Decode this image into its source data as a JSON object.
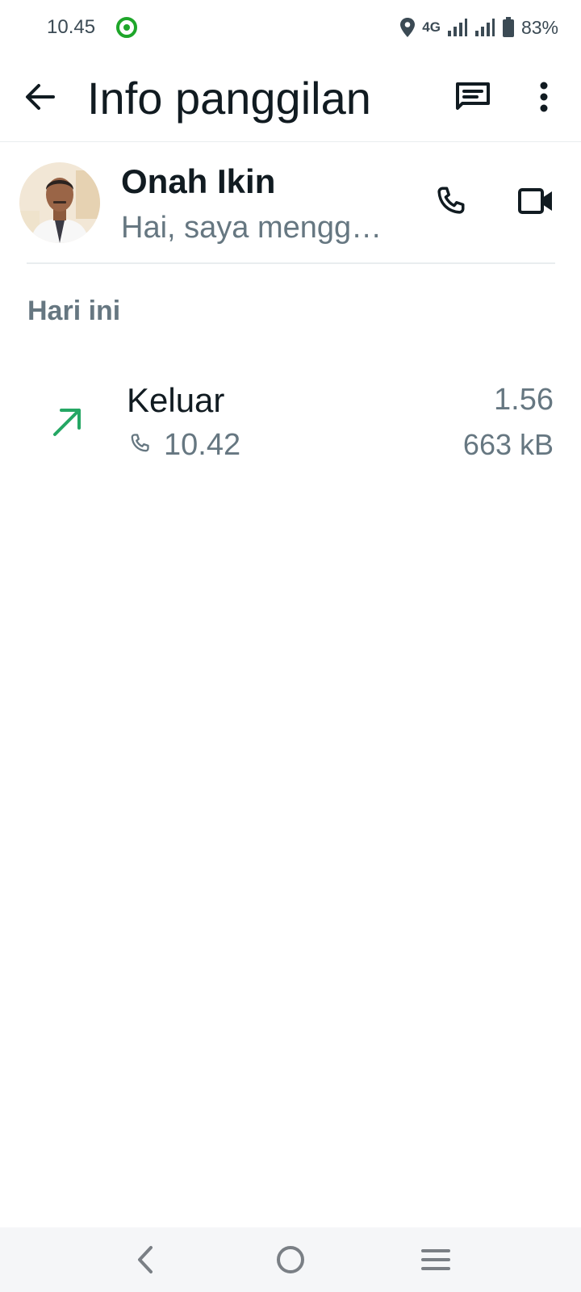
{
  "status_bar": {
    "time": "10.45",
    "network_label": "4G",
    "battery": "83%",
    "icons": [
      "app-notification-icon",
      "location-icon",
      "signal-icon",
      "battery-icon"
    ]
  },
  "app_bar": {
    "title": "Info panggilan",
    "icons": [
      "back-arrow-icon",
      "message-icon",
      "more-vertical-icon"
    ]
  },
  "contact": {
    "name": "Onah Ikin",
    "status": "Hai, saya mengg…",
    "icons": [
      "voice-call-icon",
      "video-call-icon"
    ]
  },
  "section": {
    "header": "Hari ini"
  },
  "call_log": [
    {
      "type": "Keluar",
      "time": "10.42",
      "duration": "1.56",
      "size": "663 kB",
      "direction_icon": "outgoing-arrow-icon"
    }
  ],
  "colors": {
    "primary_text": "#111b21",
    "secondary_text": "#667781",
    "outgoing_green": "#25a764",
    "status_green": "#1ea62a",
    "nav_background": "#f5f6f8"
  },
  "nav_bar": {
    "icons": [
      "nav-back-icon",
      "nav-home-icon",
      "nav-recents-icon"
    ]
  }
}
